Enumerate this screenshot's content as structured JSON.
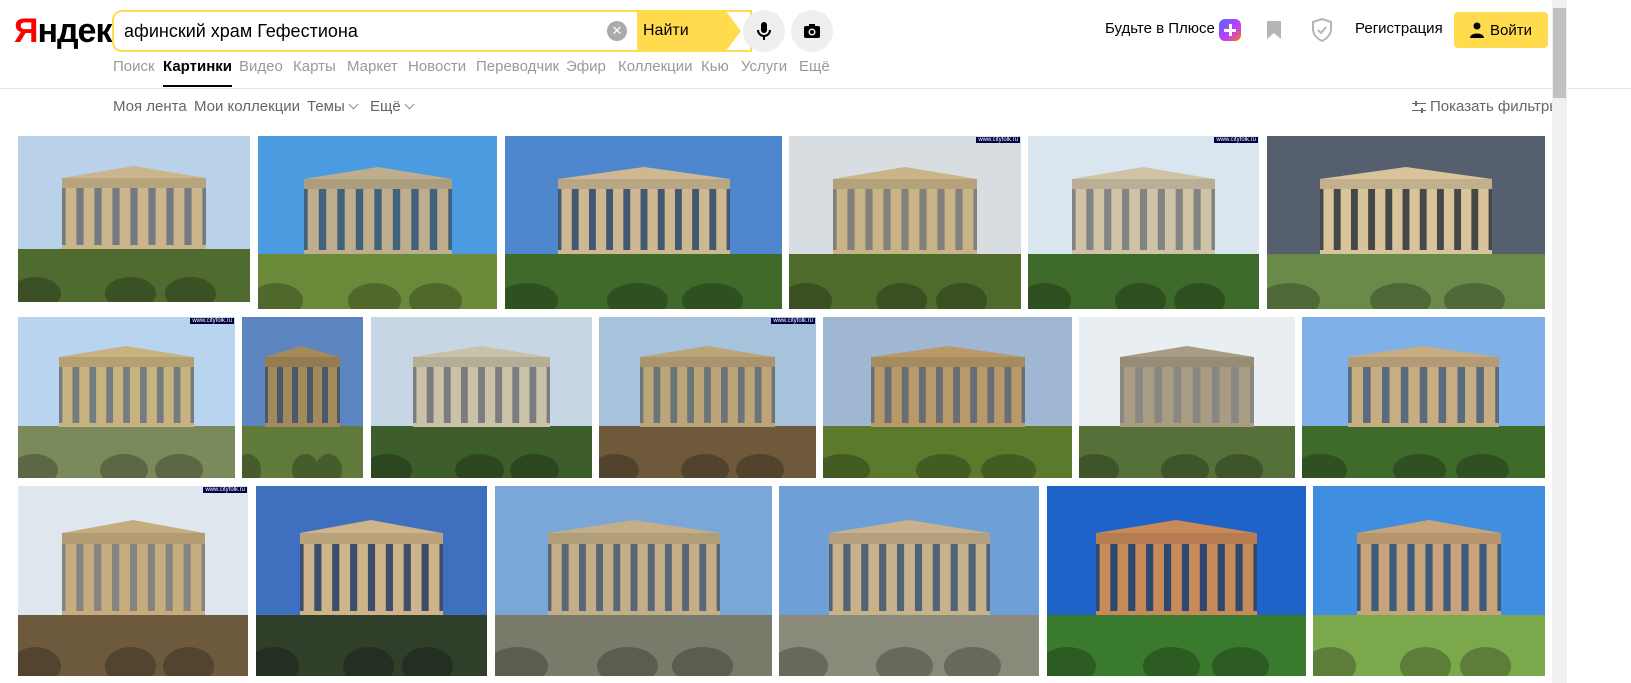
{
  "logo": {
    "first": "Я",
    "rest": "ндекс"
  },
  "search": {
    "query": "афинский храм Гефестиона",
    "find_label": "Найти"
  },
  "header": {
    "plus_label": "Будьте в Плюсе",
    "register_label": "Регистрация",
    "login_label": "Войти"
  },
  "tabs": [
    {
      "label": "Поиск",
      "active": false
    },
    {
      "label": "Картинки",
      "active": true
    },
    {
      "label": "Видео",
      "active": false
    },
    {
      "label": "Карты",
      "active": false
    },
    {
      "label": "Маркет",
      "active": false
    },
    {
      "label": "Новости",
      "active": false
    },
    {
      "label": "Переводчик",
      "active": false
    },
    {
      "label": "Эфир",
      "active": false
    },
    {
      "label": "Коллекции",
      "active": false
    },
    {
      "label": "Кью",
      "active": false
    },
    {
      "label": "Услуги",
      "active": false
    },
    {
      "label": "Ещё",
      "active": false
    }
  ],
  "subnav": {
    "feed": "Моя лента",
    "collections": "Мои коллекции",
    "themes": "Темы",
    "more": "Ещё",
    "filters": "Показать фильтры"
  },
  "colors": {
    "accent": "#ffdb4d",
    "logo_red": "#ff0000"
  },
  "images": [
    {
      "sky": "#b9d2ea",
      "ground": "#4f6b2f",
      "stone": "#cbb58c",
      "watermark": ""
    },
    {
      "sky": "#4a9be0",
      "ground": "#6a8a3a",
      "stone": "#bfae8d",
      "watermark": ""
    },
    {
      "sky": "#4f87cf",
      "ground": "#3f6a2a",
      "stone": "#cdb892",
      "watermark": ""
    },
    {
      "sky": "#d8dde2",
      "ground": "#4e6b2c",
      "stone": "#c9b487",
      "watermark": "www.cityfolk.ru"
    },
    {
      "sky": "#d9e6ef",
      "ground": "#3d6a2a",
      "stone": "#cfc2a5",
      "watermark": "www.cityfolk.ru"
    },
    {
      "sky": "#555f6d",
      "ground": "#6a8a4a",
      "stone": "#d8c39b",
      "watermark": ""
    },
    {
      "sky": "#b8d4ee",
      "ground": "#7b8a5a",
      "stone": "#c8b27f",
      "watermark": "www.cityfolk.ru"
    },
    {
      "sky": "#5d86c0",
      "ground": "#5f7a3a",
      "stone": "#a48a5a",
      "watermark": ""
    },
    {
      "sky": "#c7d6e4",
      "ground": "#3d5e2a",
      "stone": "#c9c1a8",
      "watermark": ""
    },
    {
      "sky": "#a7c3dc",
      "ground": "#6e5a3a",
      "stone": "#bda57a",
      "watermark": "www.cityfolk.ru"
    },
    {
      "sky": "#9fb7d2",
      "ground": "#5b7a2c",
      "stone": "#b89a6a",
      "watermark": ""
    },
    {
      "sky": "#e8eef2",
      "ground": "#557038",
      "stone": "#a89c82",
      "watermark": ""
    },
    {
      "sky": "#7fb1e8",
      "ground": "#3e6a2a",
      "stone": "#c7ad82",
      "watermark": ""
    },
    {
      "sky": "#dfe7ee",
      "ground": "#6d5a3e",
      "stone": "#c6ad80",
      "watermark": "www.cityfolk.ru"
    },
    {
      "sky": "#3f6fbf",
      "ground": "#2f3f2a",
      "stone": "#cdb48a",
      "watermark": ""
    },
    {
      "sky": "#7aa7d8",
      "ground": "#7a7a6a",
      "stone": "#c4ae88",
      "watermark": ""
    },
    {
      "sky": "#6e9fd6",
      "ground": "#8a8a7a",
      "stone": "#c8b28c",
      "watermark": ""
    },
    {
      "sky": "#1f62c8",
      "ground": "#3a7a2e",
      "stone": "#c98a5a",
      "watermark": ""
    },
    {
      "sky": "#3f8ee0",
      "ground": "#7aa84a",
      "stone": "#c9a47a",
      "watermark": ""
    }
  ]
}
